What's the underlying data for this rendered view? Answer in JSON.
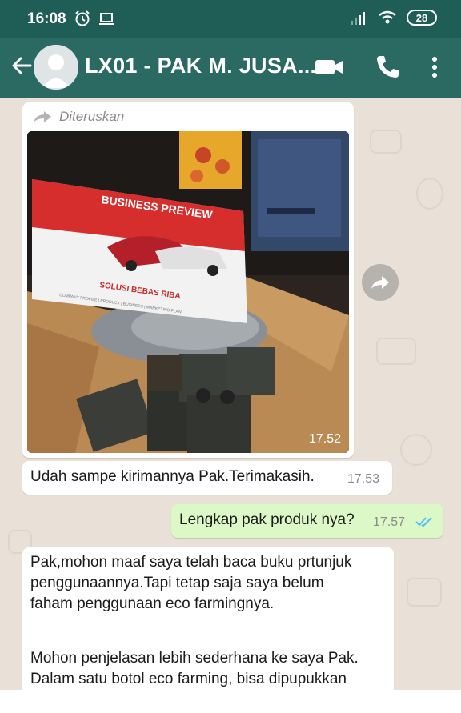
{
  "status_bar": {
    "time": "16:08",
    "battery": "28"
  },
  "header": {
    "title": "LX01 - PAK M. JUSA..."
  },
  "messages": {
    "forwarded_image": {
      "forwarded_label": "Diteruskan",
      "time": "17.52"
    },
    "msg1": {
      "text": "Udah sampe kirimannya Pak.Terimakasih.",
      "time": "17.53"
    },
    "msg2": {
      "text": "Lengkap pak produk nya?",
      "time": "17.57"
    },
    "msg3": {
      "lines": [
        "Pak,mohon maaf saya telah baca buku prtunjuk",
        "penggunaannya.Tapi tetap saja saya belum",
        "faham penggunaan eco farmingnya.",
        "Mohon penjelasan lebih sederhana ke saya Pak.",
        "Dalam satu botol eco farming, bisa dipupukkan"
      ]
    }
  },
  "photo": {
    "book_title": "BUSINESS PREVIEW",
    "book_subtitle": "SOLUSI BEBAS RIBA",
    "book_caption": "COMPANY PROFILE | PRODUCT | BUSINESS | MARKETING PLAN"
  },
  "icons": {
    "back": "back-arrow-icon",
    "video": "video-call-icon",
    "call": "phone-icon",
    "menu": "more-vert-icon",
    "forward": "forward-icon",
    "read": "double-check-icon"
  },
  "colors": {
    "header": "#2b6a63",
    "status": "#1f5d57",
    "bubble_out": "#dcf8c6",
    "read_ticks": "#4fc3f7"
  }
}
